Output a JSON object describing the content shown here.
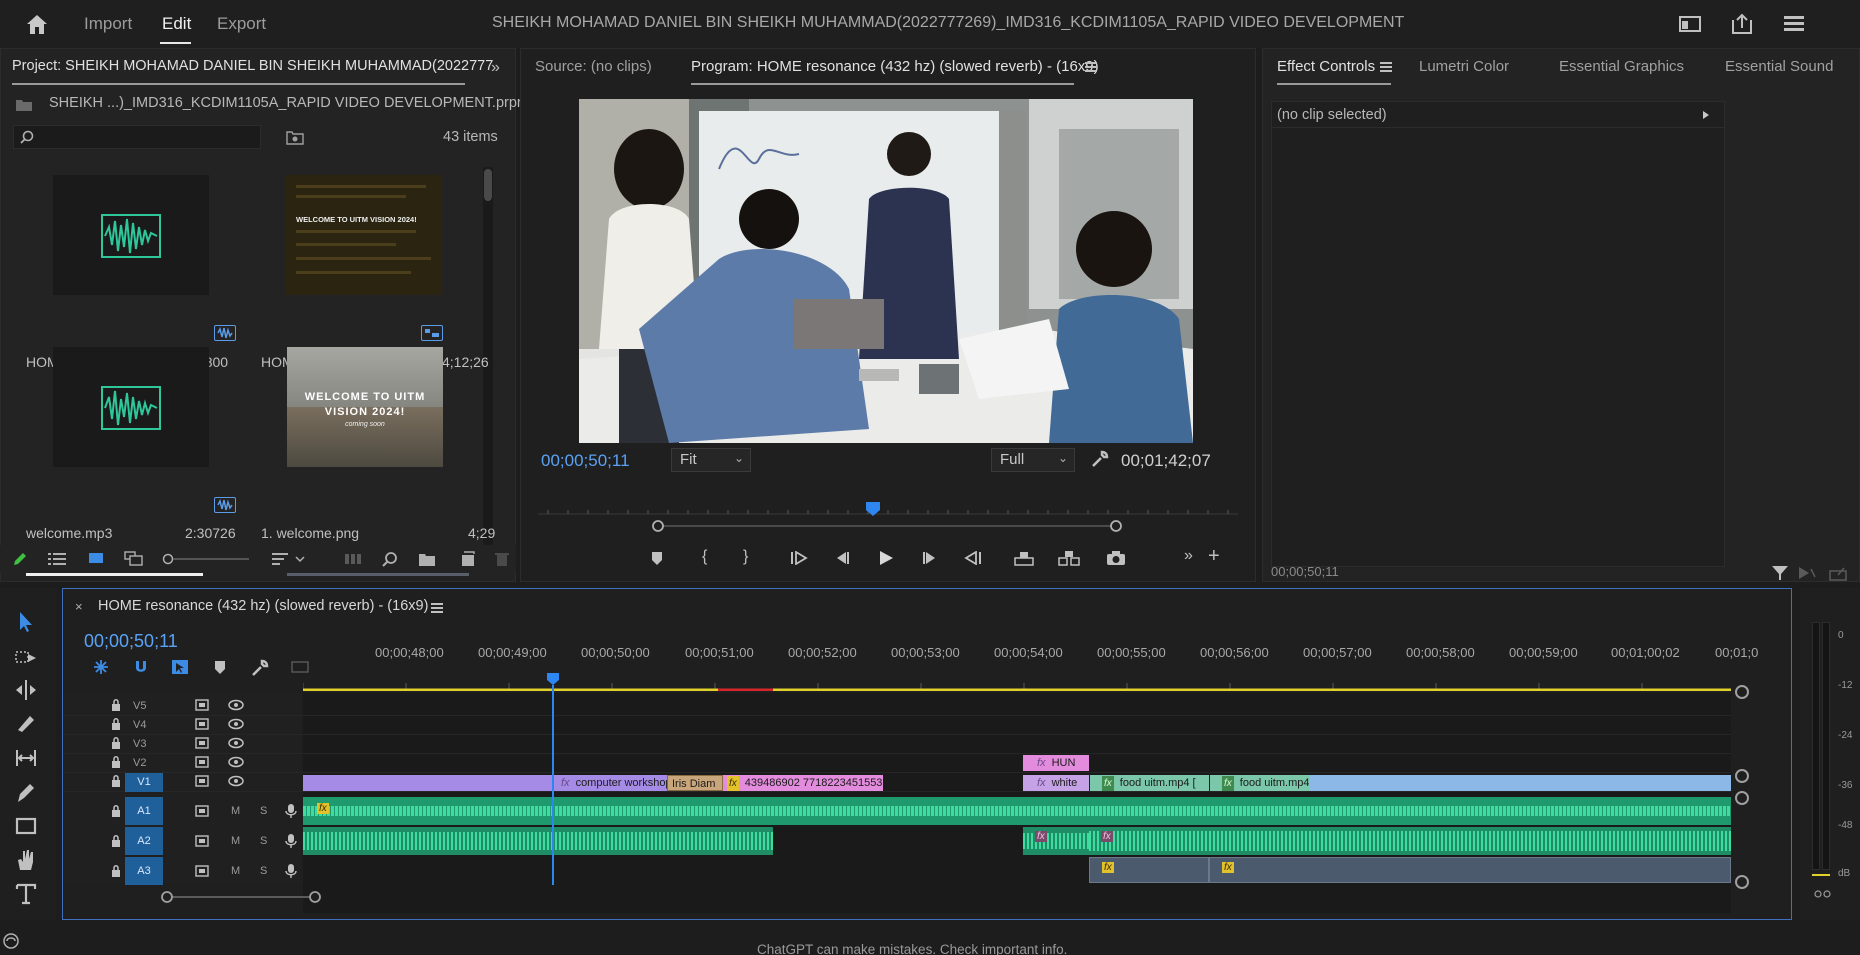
{
  "topbar": {
    "tabs": [
      "Import",
      "Edit",
      "Export"
    ],
    "active_tab": "Edit",
    "title": "SHEIKH MOHAMAD DANIEL BIN SHEIKH MUHAMMAD(2022777269)_IMD316_KCDIM1105A_RAPID VIDEO DEVELOPMENT",
    "icons": [
      "home-icon",
      "workspace-icon",
      "share-icon",
      "panel-menu-icon"
    ]
  },
  "project": {
    "title": "Project: SHEIKH MOHAMAD DANIEL BIN SHEIKH MUHAMMAD(2022777",
    "file": "SHEIKH ...)_IMD316_KCDIM1105A_RAPID VIDEO DEVELOPMENT.prproj",
    "item_count": "43 items",
    "items": [
      {
        "label": "HOME  resonance (...",
        "duration": "4:20:02800",
        "kind": "audio"
      },
      {
        "label": "HOME  resonance (432...",
        "duration": "4;12;26",
        "kind": "sequence"
      },
      {
        "label": "welcome.mp3",
        "duration": "2:30726",
        "kind": "audio"
      },
      {
        "label": "1. welcome.png",
        "duration": "4;29",
        "kind": "image"
      }
    ],
    "thumb_text": {
      "sequence_line": "WELCOME TO UITM VISION 2024!",
      "welcome_line1": "WELCOME TO UITM",
      "welcome_line2": "VISION 2024!",
      "welcome_line3": "coming soon"
    }
  },
  "monitor": {
    "source_tab": "Source: (no clips)",
    "program_tab": "Program: HOME  resonance (432 hz) (slowed  reverb) - (16x9)",
    "current_tc": "00;00;50;11",
    "zoom": "Fit",
    "quality": "Full",
    "duration_tc": "00;01;42;07"
  },
  "effects": {
    "tabs": [
      "Effect Controls",
      "Lumetri Color",
      "Essential Graphics",
      "Essential Sound"
    ],
    "active_tab": "Effect Controls",
    "no_clip": "(no clip selected)",
    "footer_tc": "00;00;50;11"
  },
  "timeline": {
    "sequence_name": "HOME  resonance (432 hz) (slowed  reverb) - (16x9)",
    "current_tc": "00;00;50;11",
    "ruler": [
      "00;00;48;00",
      "00;00;49;00",
      "00;00;50;00",
      "00;00;51;00",
      "00;00;52;00",
      "00;00;53;00",
      "00;00;54;00",
      "00;00;55;00",
      "00;00;56;00",
      "00;00;57;00",
      "00;00;58;00",
      "00;00;59;00",
      "00;01;00;02",
      "00;01;0"
    ],
    "video_tracks": [
      "V5",
      "V4",
      "V3",
      "V2",
      "V1"
    ],
    "audio_tracks": [
      "A1",
      "A2",
      "A3"
    ],
    "track_buttons": {
      "mute": "M",
      "solo": "S"
    },
    "clips": {
      "computer_workshop": "computer workshop.mp4",
      "iris": "Iris Diam",
      "number_clip": "439486902  7718223451553",
      "hun": "HUN",
      "white": "white",
      "food1": "food uitm.mp4 [",
      "food2": "food uitm.mp4 [V]",
      "fx": "fx"
    },
    "meter_scale": [
      "0",
      "-12",
      "-24",
      "-36",
      "-48",
      "dB"
    ]
  },
  "colors": {
    "accent_blue": "#5aa2f5",
    "clip_video": "#a58be6",
    "clip_pink": "#e38bdc",
    "clip_green": "#7bc7a9",
    "clip_teal": "#8bb8e6",
    "audio_green": "#2fbf8b"
  },
  "statusbar": {
    "notice": "ChatGPT can make mistakes. Check important info."
  }
}
